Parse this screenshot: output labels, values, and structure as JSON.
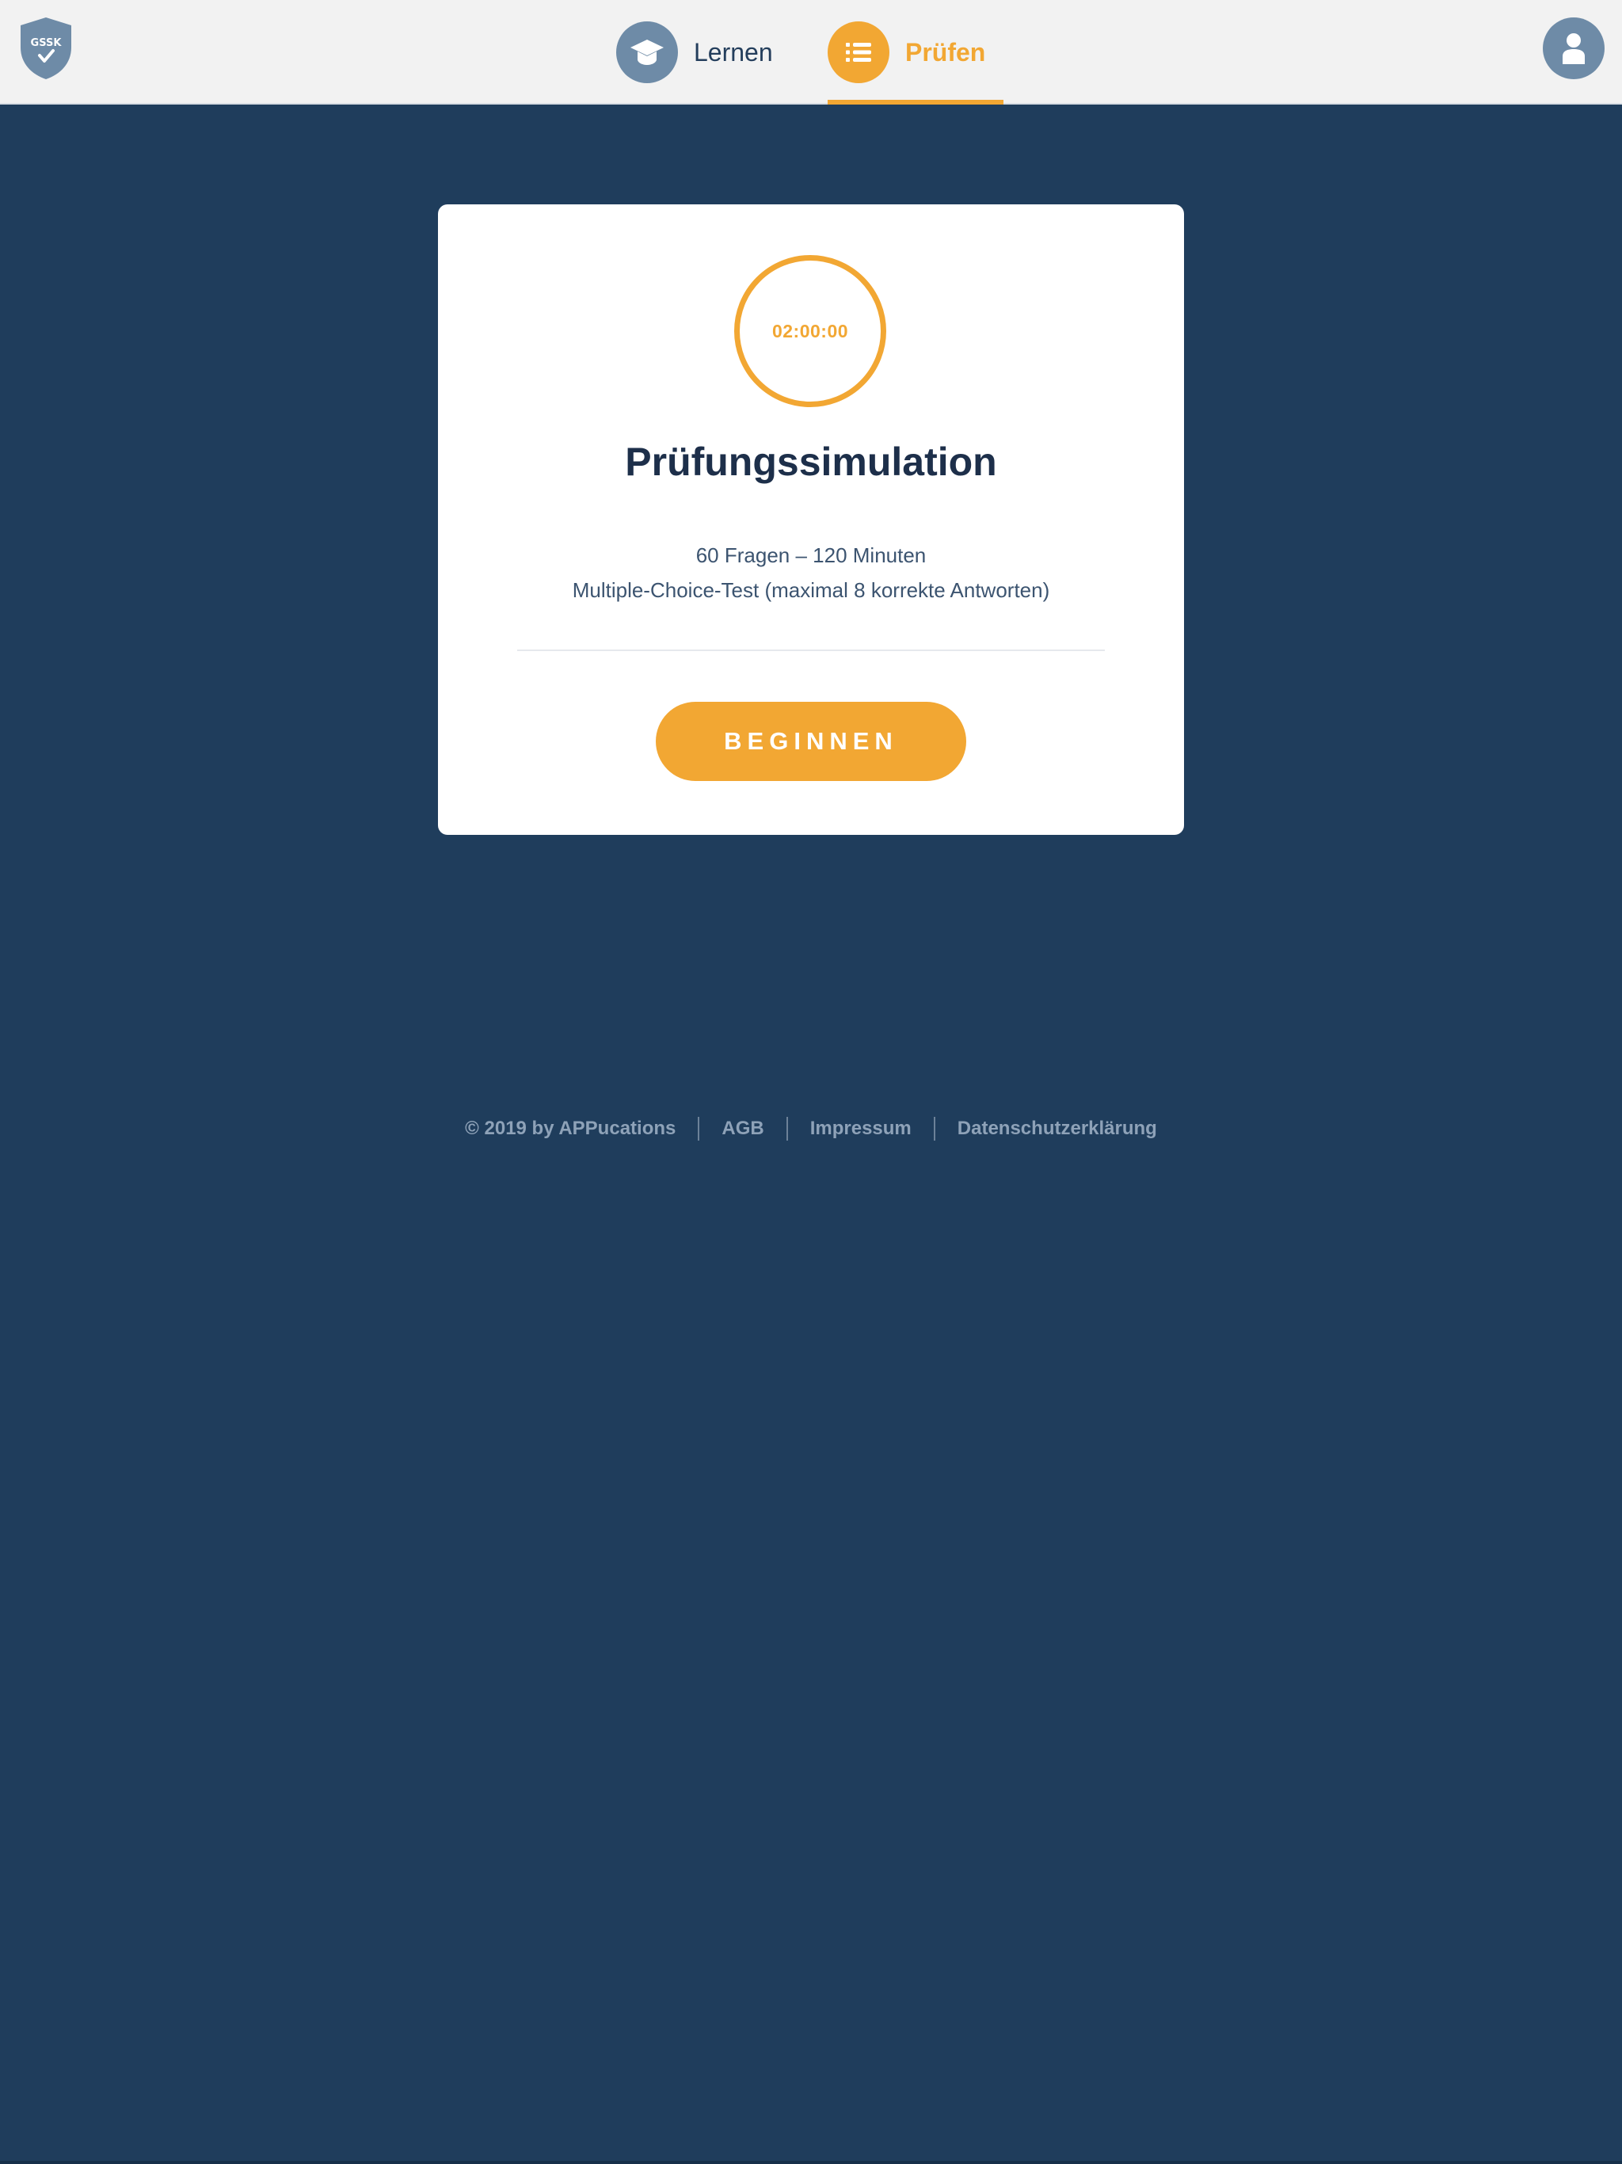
{
  "header": {
    "logo_icon": "shield-logo-icon",
    "logo_text": "GSSK",
    "nav": [
      {
        "label": "Lernen",
        "icon": "graduation-cap-icon",
        "active": false
      },
      {
        "label": "Prüfen",
        "icon": "list-icon",
        "active": true
      }
    ],
    "profile_icon": "user-icon"
  },
  "card": {
    "timer": "02:00:00",
    "title": "Prüfungssimulation",
    "line1": "60 Fragen – 120 Minuten",
    "line2": "Multiple-Choice-Test (maximal 8 korrekte Antworten)",
    "button_label": "BEGINNEN"
  },
  "footer": {
    "copyright": "© 2019 by APPucations",
    "links": [
      "AGB",
      "Impressum",
      "Datenschutzerklärung"
    ]
  },
  "colors": {
    "background": "#1f3d5c",
    "accent": "#f2a733",
    "muted_icon": "#6e8ba7",
    "header_bg": "#f2f2f2",
    "title": "#1d2f4a"
  }
}
